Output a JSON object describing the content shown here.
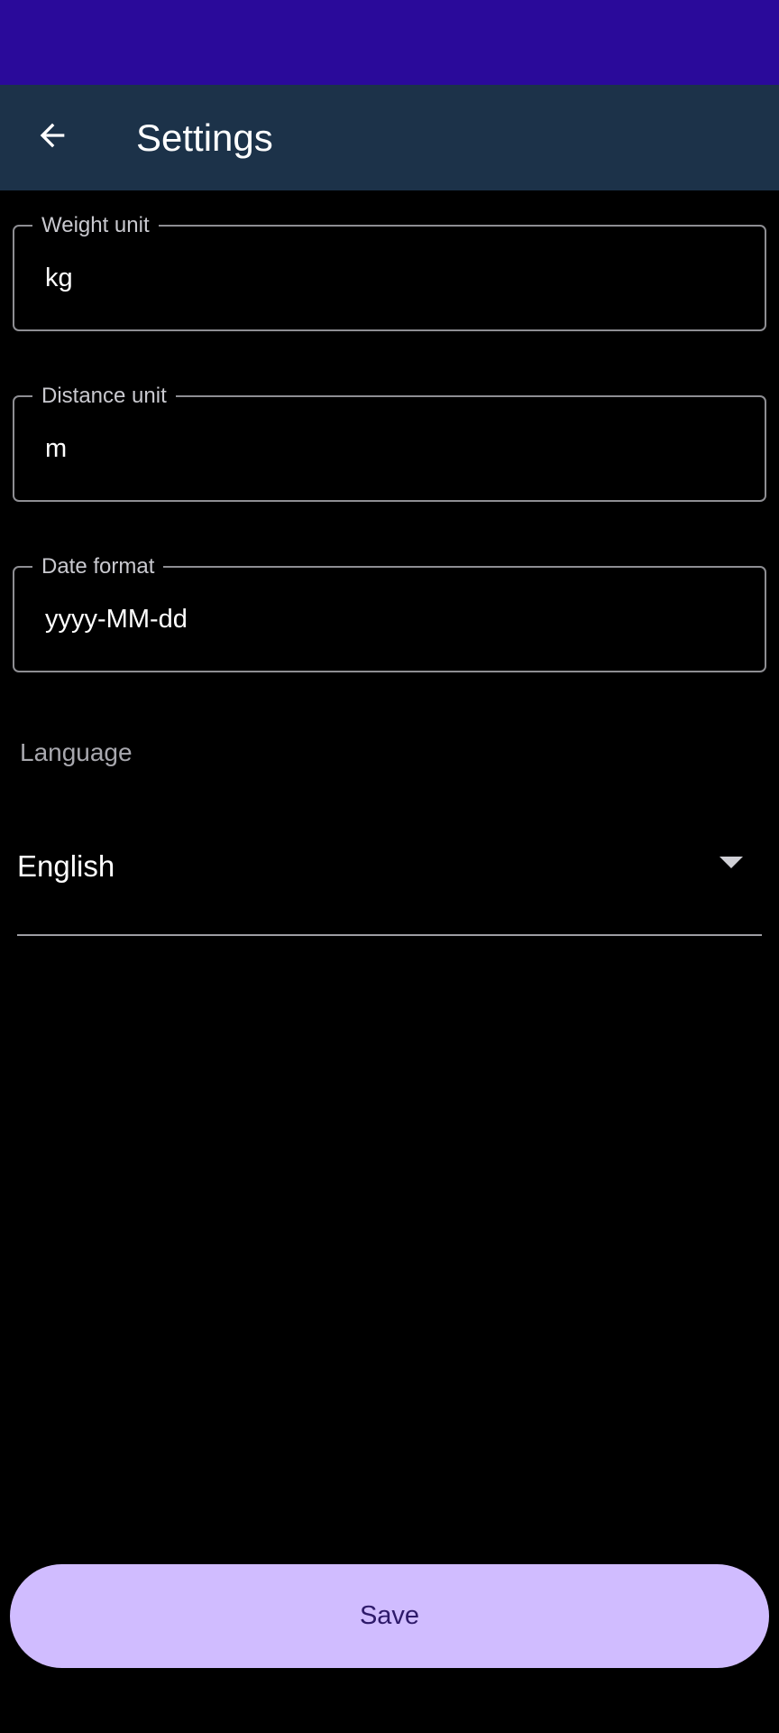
{
  "app_bar": {
    "title": "Settings",
    "back_icon": "arrow-back-icon"
  },
  "fields": {
    "weight": {
      "label": "Weight unit",
      "value": "kg"
    },
    "distance": {
      "label": "Distance unit",
      "value": "m"
    },
    "date": {
      "label": "Date format",
      "value": "yyyy-MM-dd"
    }
  },
  "language": {
    "label": "Language",
    "selected": "English",
    "icon": "dropdown-arrow-icon"
  },
  "actions": {
    "save_label": "Save"
  },
  "colors": {
    "status_bar": "#2a0a9a",
    "app_bar": "#1c3249",
    "background": "#000000",
    "save_button": "#d0bcff",
    "save_text": "#2e1a6a"
  }
}
